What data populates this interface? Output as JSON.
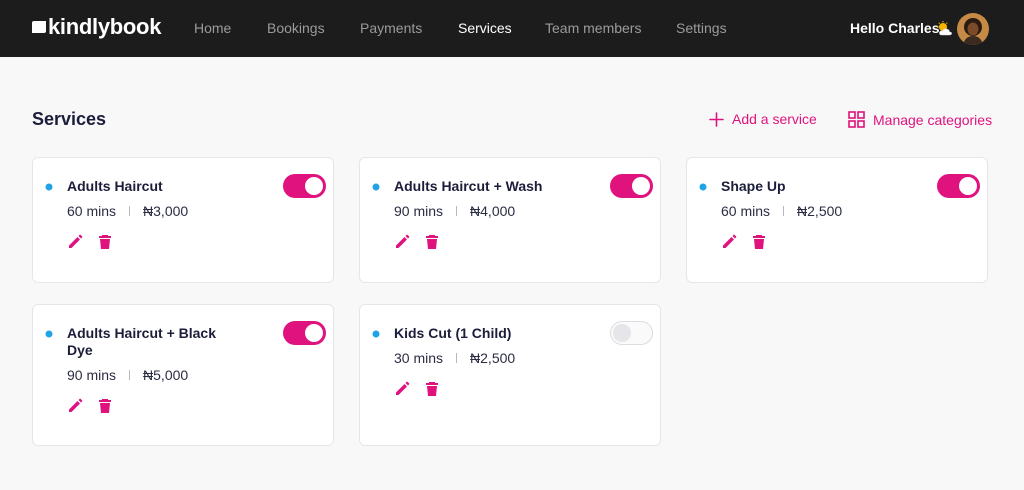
{
  "brand": {
    "name": "kindlybook",
    "accent": "#e0137e",
    "dot_color": "#1fa3e5"
  },
  "nav": {
    "items": [
      {
        "label": "Home",
        "active": false
      },
      {
        "label": "Bookings",
        "active": false
      },
      {
        "label": "Payments",
        "active": false
      },
      {
        "label": "Services",
        "active": true
      },
      {
        "label": "Team members",
        "active": false
      },
      {
        "label": "Settings",
        "active": false
      }
    ],
    "greeting": "Hello Charles",
    "weather_icon": "sun-behind-cloud-icon"
  },
  "page": {
    "title": "Services",
    "actions": {
      "add_service": "Add a service",
      "manage_categories": "Manage categories"
    }
  },
  "services": [
    {
      "name": "Adults Haircut",
      "duration": "60 mins",
      "price": "₦3,000",
      "enabled": true
    },
    {
      "name": "Adults Haircut + Wash",
      "duration": "90 mins",
      "price": "₦4,000",
      "enabled": true
    },
    {
      "name": "Shape Up",
      "duration": "60 mins",
      "price": "₦2,500",
      "enabled": true
    },
    {
      "name": "Adults Haircut + Black Dye",
      "duration": "90 mins",
      "price": "₦5,000",
      "enabled": true
    },
    {
      "name": "Kids Cut (1 Child)",
      "duration": "30 mins",
      "price": "₦2,500",
      "enabled": false
    }
  ]
}
